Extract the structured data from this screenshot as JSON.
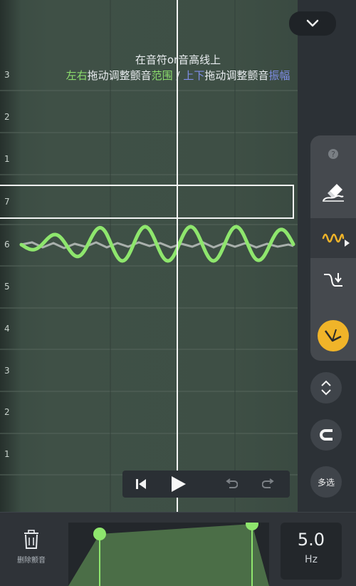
{
  "hint": {
    "line1": "在音符or音高线上",
    "seg_left_right": "左右",
    "seg_drag_a": "拖动调整颤音",
    "seg_range": "范围",
    "seg_slash": "/",
    "seg_up_down": "上下",
    "seg_drag_b": "拖动调整颤音",
    "seg_amplitude": "振幅"
  },
  "row_labels": [
    "3",
    "2",
    "1",
    "7",
    "6",
    "5",
    "4",
    "3",
    "2",
    "1"
  ],
  "toolbar": {
    "help_icon": "question-icon",
    "active_tool": "vibrato",
    "tools": [
      "eraser",
      "vibrato",
      "pitch-slide",
      "pitch-line"
    ]
  },
  "side_buttons": {
    "multi_select_label": "多选"
  },
  "bottom": {
    "delete_label": "删除颤音",
    "rate_value": "5.0",
    "rate_unit": "Hz"
  },
  "colors": {
    "accent_green": "#8ee66d",
    "accent_yellow": "#f0b429",
    "hint_blue": "#7f8ee8"
  }
}
